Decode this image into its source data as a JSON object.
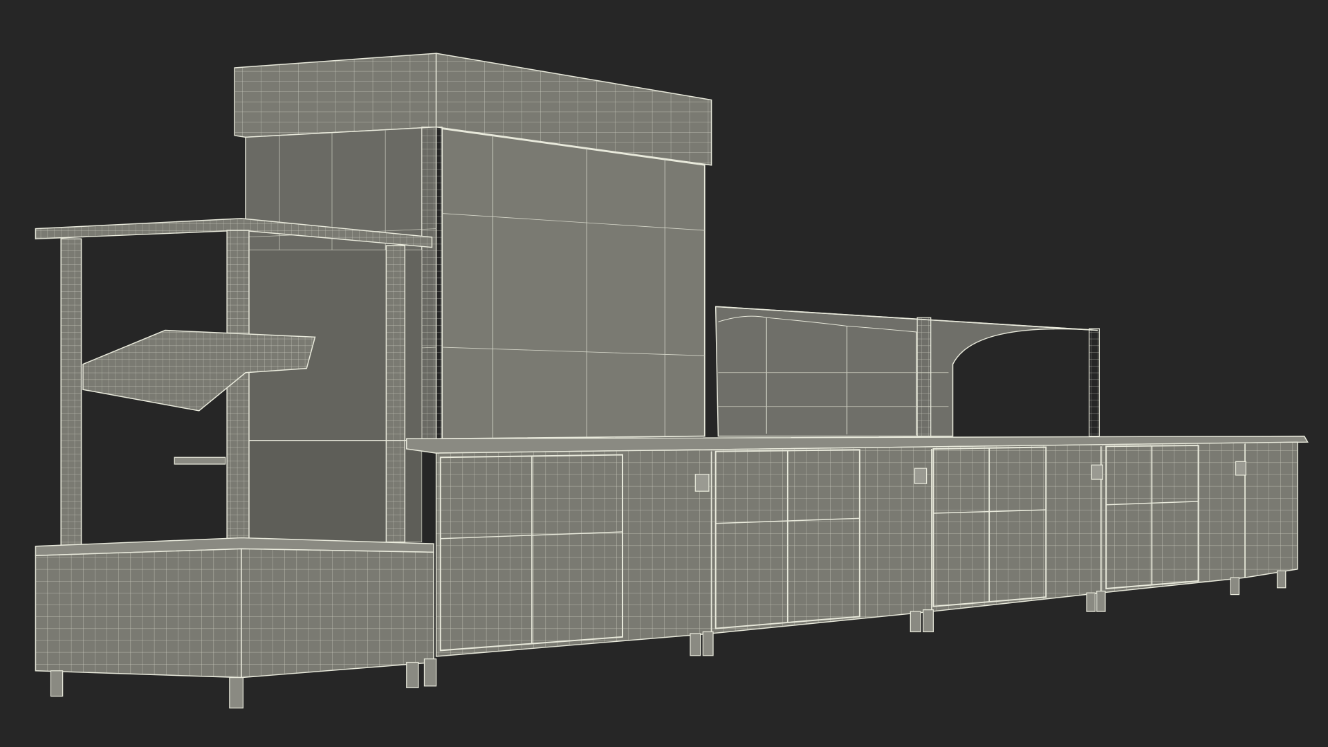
{
  "scene": {
    "subject": "wireframe-render-of-food-serving-counter",
    "colors": {
      "background": "#262626",
      "panel": "#7a7a72",
      "panel_dark": "#5e5e58",
      "panel_light": "#8a8a82",
      "wire": "#e9eadc",
      "wire_faint": "#c9cabd"
    }
  }
}
